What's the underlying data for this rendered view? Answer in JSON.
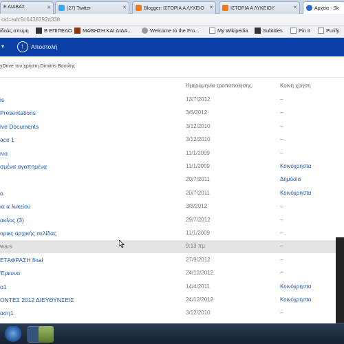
{
  "browser": {
    "tabs": [
      {
        "label": "Ε ΔΙΑΒΑΣ",
        "active": false
      },
      {
        "label": "(27) Twitter",
        "active": false
      },
      {
        "label": "Blogger: ΙΣΤΟΡΙΑ Α ΛΥΚΕΙΟ",
        "active": false
      },
      {
        "label": "ΙΣΤΟΡΙΑ Α ΛΥΚΕΙΟΥ",
        "active": false
      },
      {
        "label": "Αρχεία - Sk",
        "active": true
      }
    ],
    "address": "cid=adc9c6438792d338",
    "bookmarks": [
      "ιδεάς σπυμη",
      "Β ΕΠΙΠΕΔΟ",
      "ΜΑΘΗΣΗ ΚΑΙ ΔΙΔΑ...",
      "Welcome to the Fro...",
      "My Wikipedia",
      "Subtitles",
      "Pin It",
      "Purify"
    ]
  },
  "toolbar": {
    "share_label": "Αποστολή"
  },
  "note": "yDrive του χρήστη Dimitris Βασιλης",
  "columns": {
    "date": "Ημερομηνία τροποποίησης",
    "sharing": "Κοινή χρήση"
  },
  "rows": [
    {
      "name": "is",
      "date": "13/7/2012",
      "sharing": "–",
      "shared": false
    },
    {
      "name": "Presentations",
      "date": "3/6/2012",
      "sharing": "–",
      "shared": false
    },
    {
      "name": "ive Documents",
      "date": "3/12/2010",
      "sharing": "–",
      "shared": false
    },
    {
      "name": "ace 1",
      "date": "3/12/2010",
      "sharing": "–",
      "shared": false
    },
    {
      "name": "ινα",
      "date": "11/1/2009",
      "sharing": "–",
      "shared": false
    },
    {
      "name": "σμένα αγαπημένα",
      "date": "11/1/2009",
      "sharing": "Κοινόχρηστα",
      "shared": true
    },
    {
      "name": "",
      "date": "20/7/2011",
      "sharing": "Δημόσια",
      "shared": true
    },
    {
      "name": "o",
      "date": "20/7/2011",
      "sharing": "Κοινόχρηστα",
      "shared": true
    },
    {
      "name": "ια α λυκείου",
      "date": "3/8/2012",
      "sharing": "–",
      "shared": false
    },
    {
      "name": "ακλος (3)",
      "date": "29/7/2012",
      "sharing": "–",
      "shared": false
    },
    {
      "name": "οριες αρχικής σελίδας",
      "date": "11/1/2009",
      "sharing": "–",
      "shared": false
    },
    {
      "name": "wars",
      "date": "9:13 πμ",
      "sharing": "–",
      "shared": false,
      "highlight": true
    },
    {
      "name": "ΕΤΑΦΡΑΣΗ final",
      "date": "27/9/2012",
      "sharing": "–",
      "shared": false
    },
    {
      "name": "Έρευνα",
      "date": "24/12/2012",
      "sharing": "–",
      "shared": false
    },
    {
      "name": "o1",
      "date": "14/4/2011",
      "sharing": "Κοινόχρηστα",
      "shared": true
    },
    {
      "name": "ΟΝΤΕΣ 2012 ΔΙΕΥΘΥΝΣΕΙΣ",
      "date": "24/12/2012",
      "sharing": "Κοινόχρηστα",
      "shared": true
    },
    {
      "name": "αση1",
      "date": "3/12/2010",
      "sharing": "–",
      "shared": false
    }
  ],
  "colors": {
    "accent": "#0a3fa6",
    "link": "#1a57b8"
  }
}
